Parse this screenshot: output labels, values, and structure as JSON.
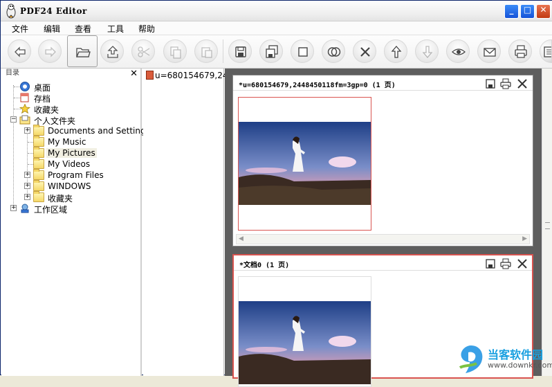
{
  "window": {
    "title": "PDF24 Editor",
    "minimize_glyph": "_",
    "maximize_glyph": "□",
    "close_glyph": "✕"
  },
  "menu": [
    "文件",
    "编辑",
    "查看",
    "工具",
    "帮助"
  ],
  "toolbar": {
    "buttons": [
      {
        "icon": "arrow-left-icon",
        "enabled": true
      },
      {
        "icon": "arrow-right-icon",
        "enabled": false
      },
      {
        "icon": "open-folder-icon",
        "enabled": true,
        "pressed": true
      },
      {
        "icon": "import-icon",
        "enabled": true
      },
      {
        "icon": "cut-icon",
        "enabled": false
      },
      {
        "icon": "copy-icon",
        "enabled": false
      },
      {
        "icon": "paste-icon",
        "enabled": false
      },
      {
        "icon": "save-icon",
        "enabled": true
      },
      {
        "icon": "save-as-icon",
        "enabled": true
      },
      {
        "icon": "new-page-icon",
        "enabled": true
      },
      {
        "icon": "merge-icon",
        "enabled": true
      },
      {
        "icon": "delete-icon",
        "enabled": true
      },
      {
        "icon": "move-up-icon",
        "enabled": true
      },
      {
        "icon": "move-down-icon",
        "enabled": false
      },
      {
        "icon": "preview-eye-icon",
        "enabled": true
      },
      {
        "icon": "email-icon",
        "enabled": true
      },
      {
        "icon": "print-icon",
        "enabled": true
      },
      {
        "icon": "settings-icon",
        "enabled": true
      }
    ]
  },
  "tree": {
    "header_label": "目录",
    "close_glyph": "✕",
    "nodes": [
      {
        "label": "桌面",
        "icon": "desktop-icon",
        "level": 0
      },
      {
        "label": "存档",
        "icon": "archive-icon",
        "level": 0
      },
      {
        "label": "收藏夹",
        "icon": "favorites-star-icon",
        "level": 0
      },
      {
        "label": "个人文件夹",
        "icon": "personal-folder-icon",
        "level": 0,
        "expanded": true
      },
      {
        "label": "Documents and Settings",
        "icon": "folder-icon",
        "level": 1
      },
      {
        "label": "My Music",
        "icon": "folder-icon",
        "level": 1
      },
      {
        "label": "My Pictures",
        "icon": "folder-icon",
        "level": 1,
        "selected": true
      },
      {
        "label": "My Videos",
        "icon": "folder-icon",
        "level": 1
      },
      {
        "label": "Program Files",
        "icon": "folder-icon",
        "level": 1
      },
      {
        "label": "WINDOWS",
        "icon": "folder-icon",
        "level": 1
      },
      {
        "label": "收藏夹",
        "icon": "folder-icon",
        "level": 1
      },
      {
        "label": "工作区域",
        "icon": "workspace-icon",
        "level": 0
      }
    ]
  },
  "files": [
    "u=680154679,24"
  ],
  "documents": [
    {
      "title": "*u=680154679,2448450118fm=3gp=0 (1 页)",
      "active": false
    },
    {
      "title": "*文档0 (1 页)",
      "active": true
    }
  ],
  "watermark": {
    "brand": "当客软件园",
    "url": "www.downkr.com"
  },
  "colors": {
    "accent_red": "#d9534f",
    "title_blue": "#1552d8",
    "doc_bg": "#5e5e5e"
  }
}
